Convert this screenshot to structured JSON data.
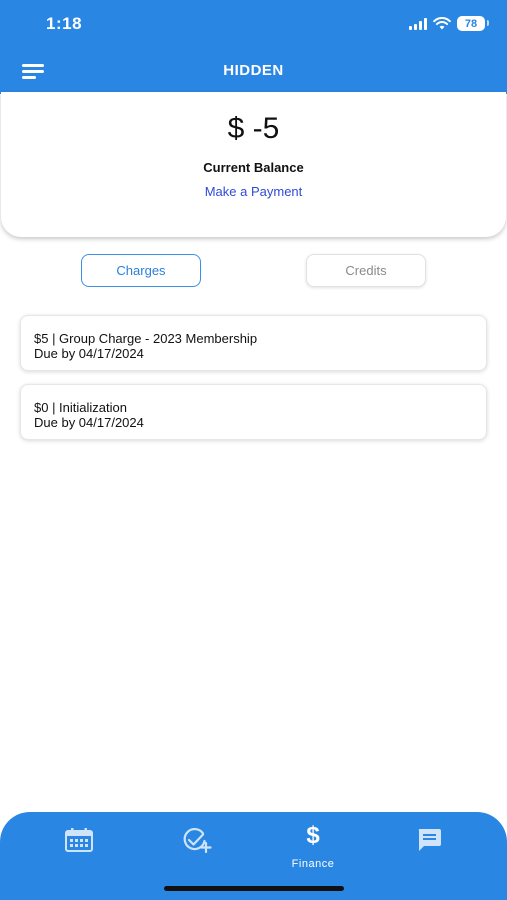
{
  "status_bar": {
    "time": "1:18",
    "battery": "78"
  },
  "header": {
    "title": "HIDDEN"
  },
  "balance": {
    "amount": "$ -5",
    "label": "Current Balance",
    "payment_link": "Make a Payment"
  },
  "tabs": [
    {
      "label": "Charges",
      "active": true
    },
    {
      "label": "Credits",
      "active": false
    }
  ],
  "charges": [
    {
      "title": "$5 | Group Charge - 2023 Membership",
      "due": "Due by 04/17/2024"
    },
    {
      "title": "$0 | Initialization",
      "due": "Due by 04/17/2024"
    }
  ],
  "bottom_nav": {
    "items": [
      {
        "icon": "calendar-icon",
        "label": ""
      },
      {
        "icon": "check-add-icon",
        "label": ""
      },
      {
        "icon": "dollar-icon",
        "label": "Finance",
        "active": true
      },
      {
        "icon": "chat-icon",
        "label": ""
      }
    ]
  },
  "colors": {
    "primary": "#2a86e3",
    "link": "#2f4ad9",
    "active_tab": "#3a8ee6"
  }
}
